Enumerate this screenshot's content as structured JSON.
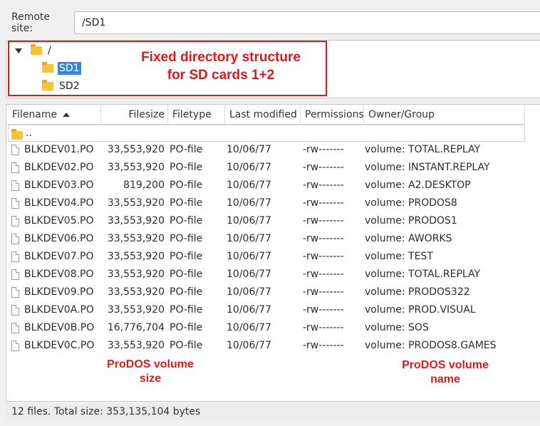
{
  "remote": {
    "label": "Remote site:",
    "path": "/SD1"
  },
  "tree": {
    "root": "/",
    "children": [
      {
        "label": "SD1",
        "selected": true
      },
      {
        "label": "SD2",
        "selected": false
      }
    ]
  },
  "annotations": {
    "tree_line1": "Fixed directory structure",
    "tree_line2": "for SD cards 1+2",
    "size_line1": "ProDOS volume",
    "size_line2": "size",
    "name_line1": "ProDOS volume",
    "name_line2": "name"
  },
  "table": {
    "headers": {
      "filename": "Filename",
      "filesize": "Filesize",
      "filetype": "Filetype",
      "modified": "Last modified",
      "permissions": "Permissions",
      "owner": "Owner/Group"
    },
    "parent_label": "..",
    "rows": [
      {
        "name": "BLKDEV01.PO",
        "size": "33,553,920",
        "type": "PO-file",
        "modified": "10/06/77",
        "perms": "-rw-------",
        "owner": "volume: TOTAL.REPLAY"
      },
      {
        "name": "BLKDEV02.PO",
        "size": "33,553,920",
        "type": "PO-file",
        "modified": "10/06/77",
        "perms": "-rw-------",
        "owner": "volume: INSTANT.REPLAY"
      },
      {
        "name": "BLKDEV03.PO",
        "size": "819,200",
        "type": "PO-file",
        "modified": "10/06/77",
        "perms": "-rw-------",
        "owner": "volume: A2.DESKTOP"
      },
      {
        "name": "BLKDEV04.PO",
        "size": "33,553,920",
        "type": "PO-file",
        "modified": "10/06/77",
        "perms": "-rw-------",
        "owner": "volume: PRODOS8"
      },
      {
        "name": "BLKDEV05.PO",
        "size": "33,553,920",
        "type": "PO-file",
        "modified": "10/06/77",
        "perms": "-rw-------",
        "owner": "volume: PRODOS1"
      },
      {
        "name": "BLKDEV06.PO",
        "size": "33,553,920",
        "type": "PO-file",
        "modified": "10/06/77",
        "perms": "-rw-------",
        "owner": "volume: AWORKS"
      },
      {
        "name": "BLKDEV07.PO",
        "size": "33,553,920",
        "type": "PO-file",
        "modified": "10/06/77",
        "perms": "-rw-------",
        "owner": "volume: TEST"
      },
      {
        "name": "BLKDEV08.PO",
        "size": "33,553,920",
        "type": "PO-file",
        "modified": "10/06/77",
        "perms": "-rw-------",
        "owner": "volume: TOTAL.REPLAY"
      },
      {
        "name": "BLKDEV09.PO",
        "size": "33,553,920",
        "type": "PO-file",
        "modified": "10/06/77",
        "perms": "-rw-------",
        "owner": "volume: PRODOS322"
      },
      {
        "name": "BLKDEV0A.PO",
        "size": "33,553,920",
        "type": "PO-file",
        "modified": "10/06/77",
        "perms": "-rw-------",
        "owner": "volume: PROD.VISUAL"
      },
      {
        "name": "BLKDEV0B.PO",
        "size": "16,776,704",
        "type": "PO-file",
        "modified": "10/06/77",
        "perms": "-rw-------",
        "owner": "volume: SOS"
      },
      {
        "name": "BLKDEV0C.PO",
        "size": "33,553,920",
        "type": "PO-file",
        "modified": "10/06/77",
        "perms": "-rw-------",
        "owner": "volume: PRODOS8.GAMES"
      }
    ]
  },
  "status": "12 files. Total size: 353,135,104 bytes",
  "colors": {
    "annotation": "#e11818",
    "selection": "#3584e4",
    "folder": "#f7c234"
  }
}
